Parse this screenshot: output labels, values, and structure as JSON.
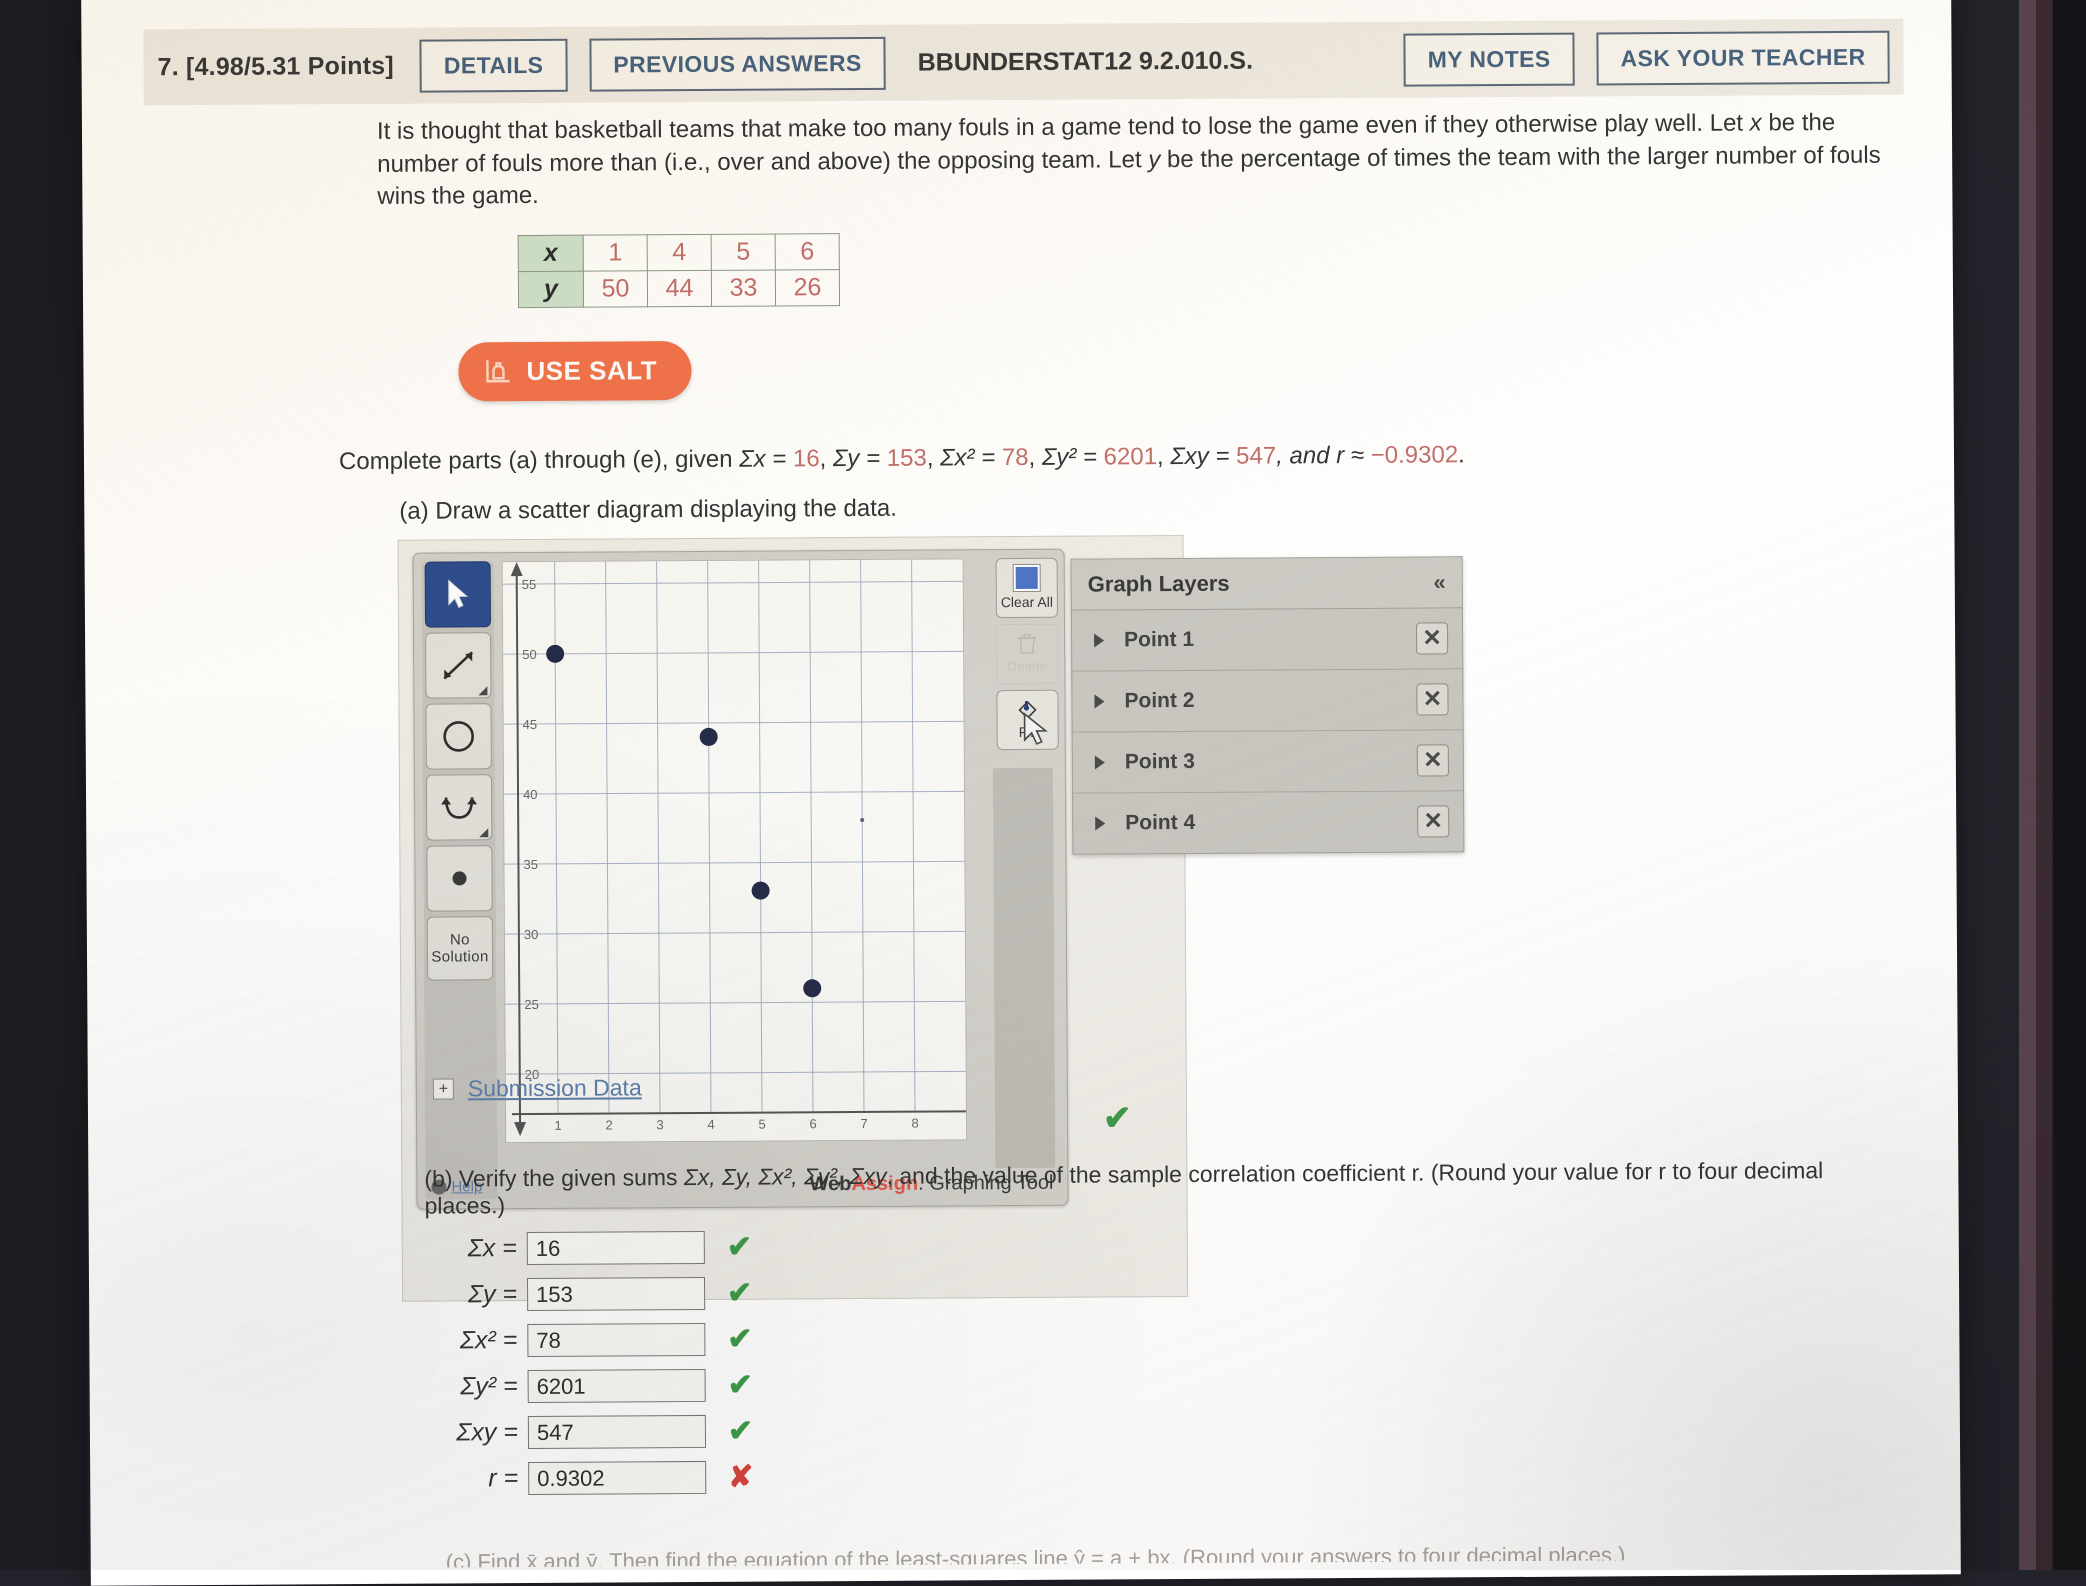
{
  "header": {
    "question_number": "7.",
    "points": "[4.98/5.31 Points]",
    "details_label": "DETAILS",
    "previous_answers_label": "PREVIOUS ANSWERS",
    "question_code": "BBUNDERSTAT12 9.2.010.S.",
    "my_notes_label": "MY NOTES",
    "ask_your_teacher_label": "ASK YOUR TEACHER"
  },
  "problem": {
    "paragraph_part1": "It is thought that basketball teams that make too many fouls in a game tend to lose the game even if they otherwise play well. Let ",
    "paragraph_x": "x",
    "paragraph_part2": " be the number of fouls more than (i.e., over and above) the opposing team. Let ",
    "paragraph_y": "y",
    "paragraph_part3": " be the percentage of times the team with the larger number of fouls wins the game.",
    "salt_label": "USE SALT",
    "given_prefix": "Complete parts (a) through (e), given ",
    "given_sums": {
      "sum_x_label": "Σx = ",
      "sum_x": "16",
      "sum_y_label": "Σy = ",
      "sum_y": "153",
      "sum_x2_label": "Σx² = ",
      "sum_x2": "78",
      "sum_y2_label": "Σy² = ",
      "sum_y2": "6201",
      "sum_xy_label": "Σxy = ",
      "sum_xy": "547",
      "r_label": ", and r ≈ ",
      "r": "−0.9302",
      "period": "."
    },
    "part_a": "(a) Draw a scatter diagram displaying the data.",
    "part_c_partial": "(c) Find x̄ and ȳ. Then find the equation of the least-squares line ŷ = a + bx. (Round your answers to four decimal places.)"
  },
  "data_table": {
    "row_x_label": "x",
    "row_y_label": "y",
    "x_values": [
      "1",
      "4",
      "5",
      "6"
    ],
    "y_values": [
      "50",
      "44",
      "33",
      "26"
    ]
  },
  "chart_data": {
    "type": "scatter",
    "title": "",
    "xlabel": "",
    "ylabel": "",
    "x": [
      1,
      4,
      5,
      6
    ],
    "y": [
      50,
      44,
      33,
      26
    ],
    "points": [
      {
        "x": 1,
        "y": 50,
        "layer": "Point 1"
      },
      {
        "x": 4,
        "y": 44,
        "layer": "Point 2"
      },
      {
        "x": 5,
        "y": 33,
        "layer": "Point 3"
      },
      {
        "x": 6,
        "y": 26,
        "layer": "Point 4"
      }
    ],
    "stray_marks": [
      {
        "x": 7,
        "y": 38
      }
    ],
    "xlim": [
      0,
      8.6
    ],
    "ylim": [
      18.5,
      56.5
    ],
    "xticks": [
      "1",
      "2",
      "3",
      "4",
      "5",
      "6",
      "7",
      "8"
    ],
    "yticks": [
      "55",
      "50",
      "45",
      "40",
      "35",
      "30",
      "25",
      "20"
    ],
    "grid": true,
    "legend": "none"
  },
  "grapher": {
    "tools": [
      {
        "name": "select-tool",
        "icon": "arrow-cursor-icon",
        "active": true
      },
      {
        "name": "line-tool",
        "icon": "double-arrow-icon",
        "active": false
      },
      {
        "name": "circle-tool",
        "icon": "circle-icon",
        "active": false
      },
      {
        "name": "parabola-tool",
        "icon": "parabola-icon",
        "active": false
      },
      {
        "name": "point-tool",
        "icon": "dot-icon",
        "active": false
      }
    ],
    "no_solution_line1": "No",
    "no_solution_line2": "Solution",
    "help_label": "Help",
    "clear_all_label": "Clear All",
    "delete_label": "Delete",
    "fill_label": "Fill",
    "watermark_web": "Web",
    "watermark_assign": "Assign",
    "watermark_tail": ". Graphing Tool",
    "layers_title": "Graph Layers",
    "collapse_icon": "«",
    "layers": [
      "Point 1",
      "Point 2",
      "Point 3",
      "Point 4"
    ],
    "close_icon": "✕"
  },
  "submission": {
    "expand_icon": "+",
    "label": "Submission Data",
    "status_mark": "✔"
  },
  "part_b": {
    "text_lead": "(b) Verify the given sums ",
    "text_sums": "Σx, Σy, Σx², Σy², Σxy",
    "text_tail": ", and the value of the sample correlation coefficient r. (Round your value for r to four decimal places.)",
    "fields": [
      {
        "label": "Σx =",
        "value": "16",
        "mark": "✔",
        "correct": true
      },
      {
        "label": "Σy =",
        "value": "153",
        "mark": "✔",
        "correct": true
      },
      {
        "label": "Σx² =",
        "value": "78",
        "mark": "✔",
        "correct": true
      },
      {
        "label": "Σy² =",
        "value": "6201",
        "mark": "✔",
        "correct": true
      },
      {
        "label": "Σxy =",
        "value": "547",
        "mark": "✔",
        "correct": true
      },
      {
        "label": "r =",
        "value": "0.9302",
        "mark": "✘",
        "correct": false
      }
    ]
  },
  "colors": {
    "accent_orange": "#f1744c",
    "link_blue": "#5d7fae",
    "correct_green": "#3d9b4a",
    "incorrect_red": "#d9443c",
    "data_red": "#c2706b",
    "table_header_green": "#cfe3cd",
    "active_tool_blue": "#2f4d8f"
  }
}
